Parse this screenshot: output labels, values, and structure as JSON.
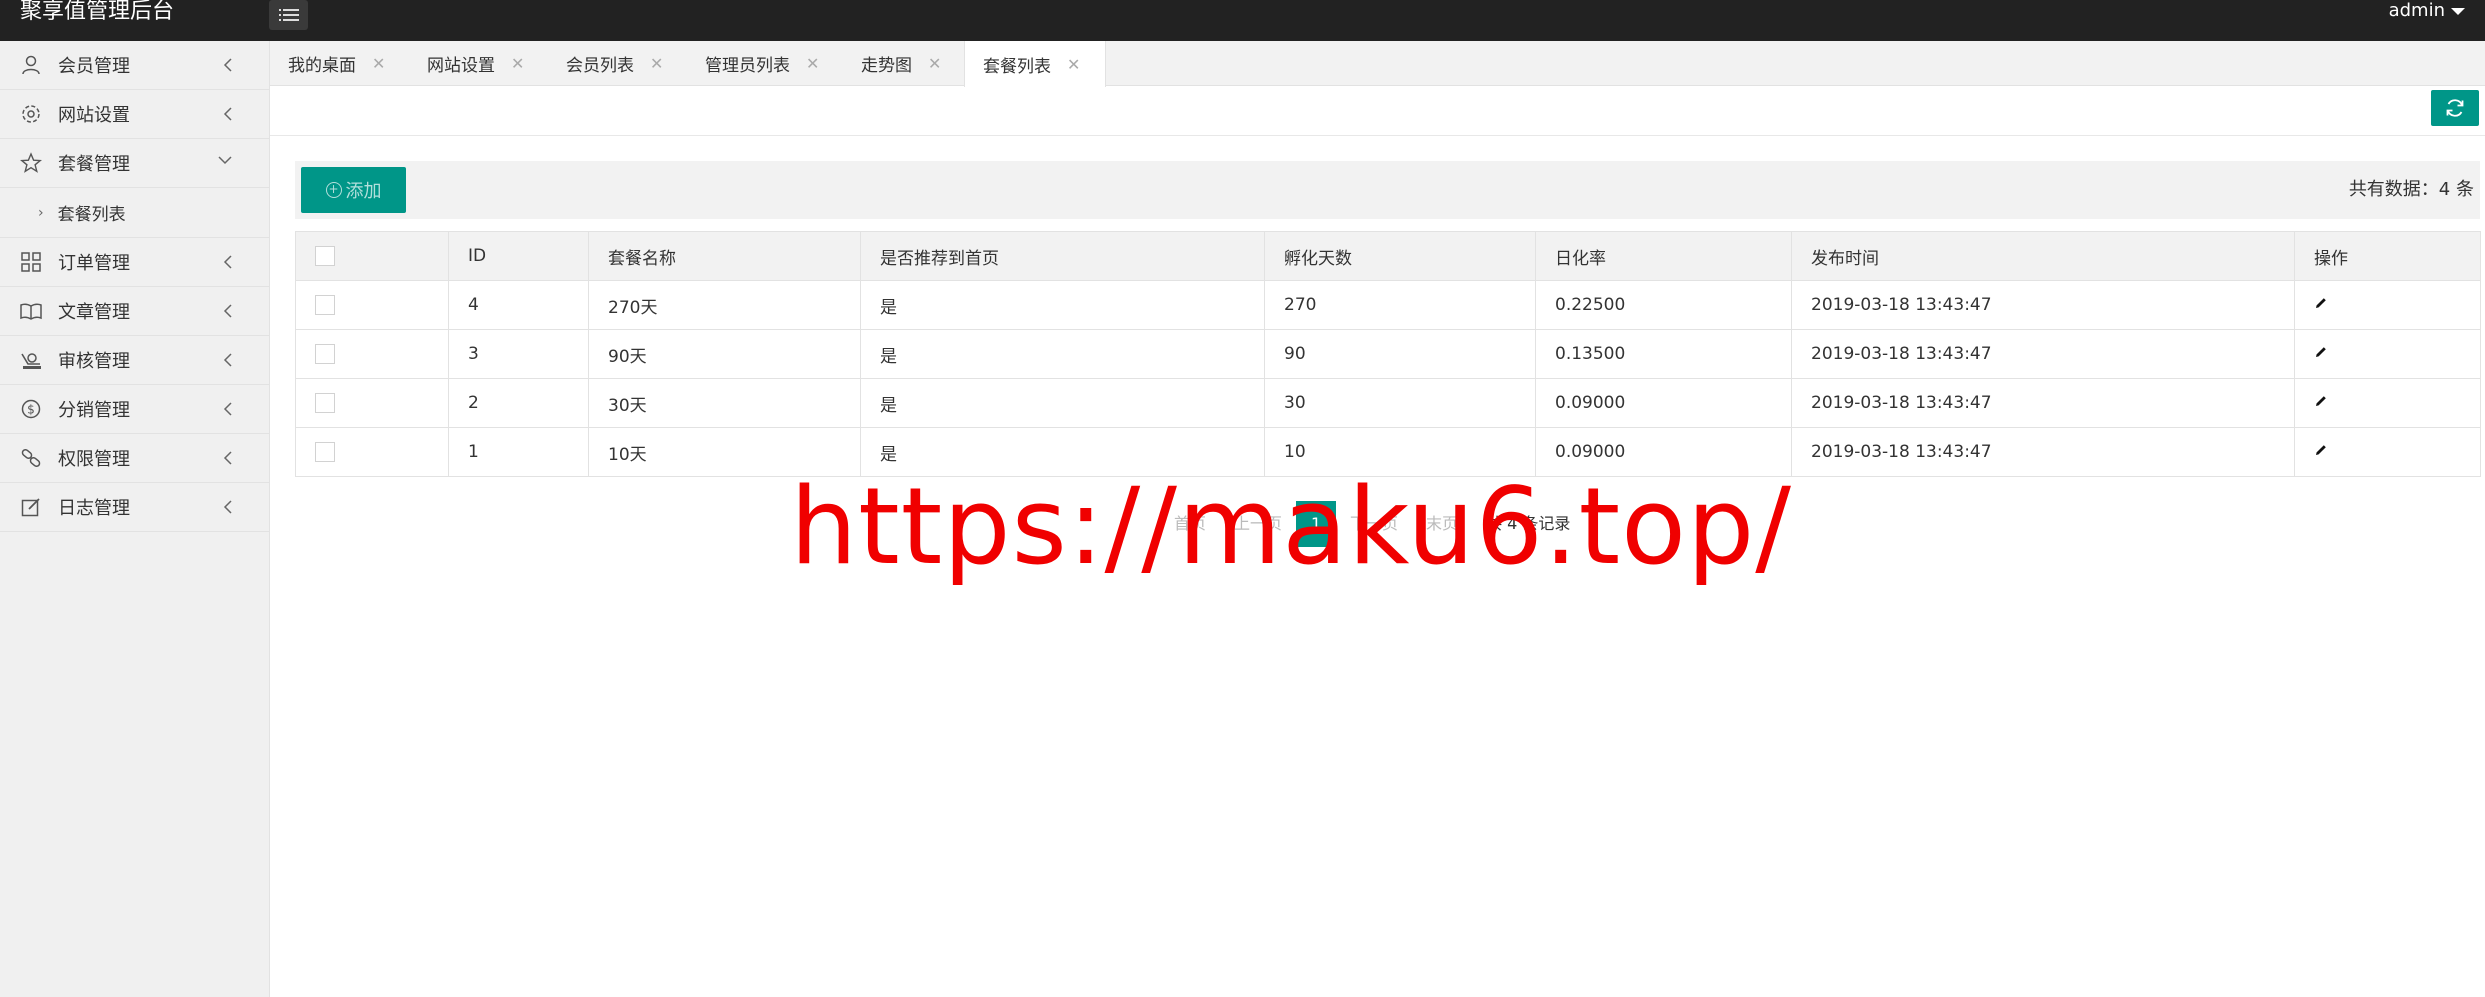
{
  "header": {
    "title": "聚享值管理后台",
    "user": "admin"
  },
  "sidebar": {
    "items": [
      {
        "label": "会员管理",
        "icon": "user-icon",
        "expanded": false
      },
      {
        "label": "网站设置",
        "icon": "gear-icon",
        "expanded": false
      },
      {
        "label": "套餐管理",
        "icon": "star-icon",
        "expanded": true,
        "children": [
          {
            "label": "套餐列表"
          }
        ]
      },
      {
        "label": "订单管理",
        "icon": "grid-icon",
        "expanded": false
      },
      {
        "label": "文章管理",
        "icon": "book-icon",
        "expanded": false
      },
      {
        "label": "审核管理",
        "icon": "stamp-icon",
        "expanded": false
      },
      {
        "label": "分销管理",
        "icon": "dollar-icon",
        "expanded": false
      },
      {
        "label": "权限管理",
        "icon": "link-icon",
        "expanded": false
      },
      {
        "label": "日志管理",
        "icon": "edit-icon",
        "expanded": false
      }
    ]
  },
  "tabs": [
    {
      "label": "我的桌面",
      "active": false
    },
    {
      "label": "网站设置",
      "active": false
    },
    {
      "label": "会员列表",
      "active": false
    },
    {
      "label": "管理员列表",
      "active": false
    },
    {
      "label": "走势图",
      "active": false
    },
    {
      "label": "套餐列表",
      "active": true
    }
  ],
  "toolbar": {
    "add_label": "添加",
    "total_text": "共有数据：4 条"
  },
  "table": {
    "columns": [
      "ID",
      "套餐名称",
      "是否推荐到首页",
      "孵化天数",
      "日化率",
      "发布时间",
      "操作"
    ],
    "rows": [
      {
        "id": "4",
        "name": "270天",
        "recommend": "是",
        "days": "270",
        "rate": "0.22500",
        "time": "2019-03-18 13:43:47"
      },
      {
        "id": "3",
        "name": "90天",
        "recommend": "是",
        "days": "90",
        "rate": "0.13500",
        "time": "2019-03-18 13:43:47"
      },
      {
        "id": "2",
        "name": "30天",
        "recommend": "是",
        "days": "30",
        "rate": "0.09000",
        "time": "2019-03-18 13:43:47"
      },
      {
        "id": "1",
        "name": "10天",
        "recommend": "是",
        "days": "10",
        "rate": "0.09000",
        "time": "2019-03-18 13:43:47"
      }
    ]
  },
  "pagination": {
    "first": "首页",
    "prev": "上一页",
    "current": "1",
    "next": "下一页",
    "last": "末页",
    "count_text": "共 4 条记录"
  },
  "watermark": "https://maku6.top/",
  "colors": {
    "topbar": "#222222",
    "accent": "#009688",
    "watermark": "#f00000"
  }
}
